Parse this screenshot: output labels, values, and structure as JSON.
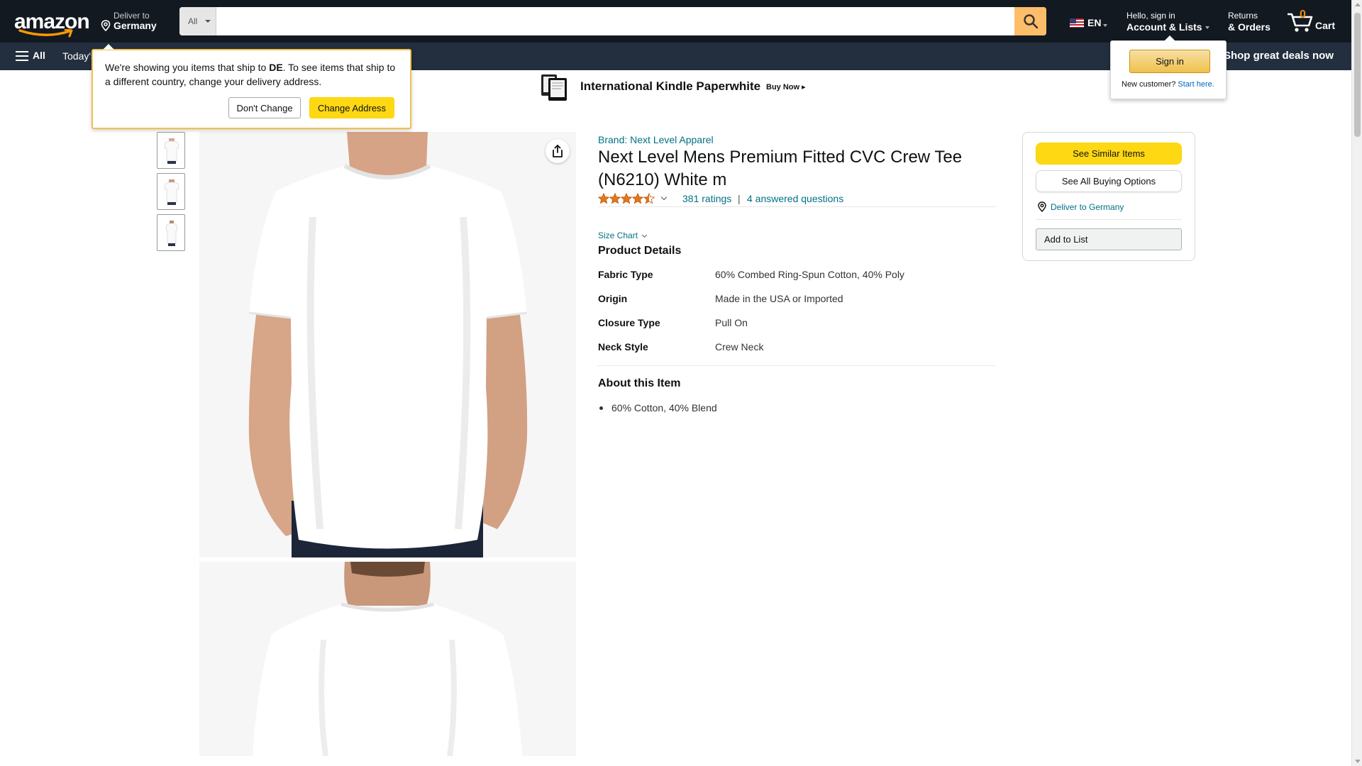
{
  "header": {
    "logo_text": "amazon",
    "deliver": {
      "line1": "Deliver to",
      "line2": "Germany"
    },
    "search": {
      "category": "All",
      "placeholder": "",
      "value": ""
    },
    "language": "EN",
    "account": {
      "line1": "Hello, sign in",
      "line2": "Account & Lists"
    },
    "returns": {
      "line1": "Returns",
      "line2": "& Orders"
    },
    "cart": {
      "count": "0",
      "label": "Cart"
    }
  },
  "subnav": {
    "all_label": "All",
    "today_label": "Today's Deals",
    "deals_label": "Shop great deals now"
  },
  "banner": {
    "title": "International Kindle Paperwhite",
    "cta": "Buy Now ▸"
  },
  "address_popover": {
    "message_before": "We're showing you items that ship to ",
    "country_code": "DE",
    "message_after": ". To see items that ship to a different country, change your delivery address.",
    "dont_change": "Don't Change",
    "change_address": "Change Address"
  },
  "signin_popover": {
    "button": "Sign in",
    "new_customer": "New customer?",
    "start_here": "Start here."
  },
  "product": {
    "brand": "Brand: Next Level Apparel",
    "title": "Next Level Mens Premium Fitted CVC Crew Tee (N6210) White m",
    "rating_value": 4.5,
    "ratings_text": "381 ratings",
    "separator": "|",
    "questions_text": "4 answered questions",
    "size_chart": "Size Chart",
    "details_heading": "Product Details",
    "details": [
      {
        "key": "Fabric Type",
        "value": "60% Combed Ring-Spun Cotton, 40% Poly"
      },
      {
        "key": "Origin",
        "value": "Made in the USA or Imported"
      },
      {
        "key": "Closure Type",
        "value": "Pull On"
      },
      {
        "key": "Neck Style",
        "value": "Crew Neck"
      }
    ],
    "about_heading": "About this Item",
    "about_items": [
      "60% Cotton, 40% Blend"
    ]
  },
  "buybox": {
    "see_similar": "See Similar Items",
    "see_all_buying": "See All Buying Options",
    "deliver_to": "Deliver to Germany",
    "add_to_list": "Add to List"
  },
  "colors": {
    "nav_dark": "#131921",
    "nav_sub": "#232f3e",
    "search_button": "#febd69",
    "primary_button": "#ffd814",
    "link": "#007185",
    "star": "#de7921",
    "cart_count": "#f08804"
  }
}
